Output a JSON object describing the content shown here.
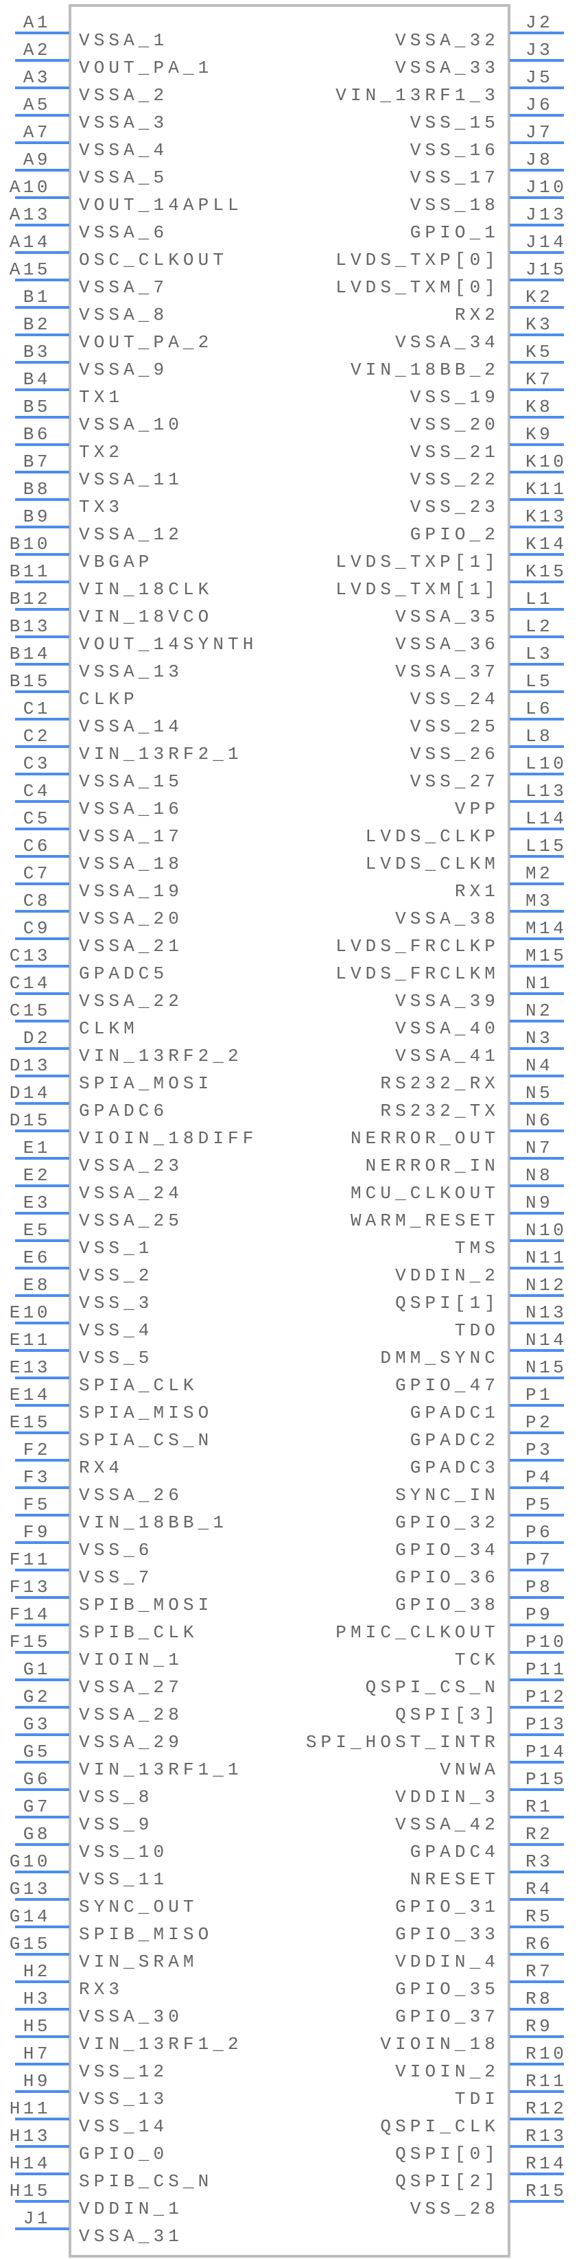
{
  "component": {
    "type": "schematic-symbol",
    "colors": {
      "body_outline": "#bdbdbd",
      "pin_line": "#4a8df0",
      "text": "#666666"
    },
    "left_pins": [
      {
        "pin": "A1",
        "name": "VSSA_1"
      },
      {
        "pin": "A2",
        "name": "VOUT_PA_1"
      },
      {
        "pin": "A3",
        "name": "VSSA_2"
      },
      {
        "pin": "A5",
        "name": "VSSA_3"
      },
      {
        "pin": "A7",
        "name": "VSSA_4"
      },
      {
        "pin": "A9",
        "name": "VSSA_5"
      },
      {
        "pin": "A10",
        "name": "VOUT_14APLL"
      },
      {
        "pin": "A13",
        "name": "VSSA_6"
      },
      {
        "pin": "A14",
        "name": "OSC_CLKOUT"
      },
      {
        "pin": "A15",
        "name": "VSSA_7"
      },
      {
        "pin": "B1",
        "name": "VSSA_8"
      },
      {
        "pin": "B2",
        "name": "VOUT_PA_2"
      },
      {
        "pin": "B3",
        "name": "VSSA_9"
      },
      {
        "pin": "B4",
        "name": "TX1"
      },
      {
        "pin": "B5",
        "name": "VSSA_10"
      },
      {
        "pin": "B6",
        "name": "TX2"
      },
      {
        "pin": "B7",
        "name": "VSSA_11"
      },
      {
        "pin": "B8",
        "name": "TX3"
      },
      {
        "pin": "B9",
        "name": "VSSA_12"
      },
      {
        "pin": "B10",
        "name": "VBGAP"
      },
      {
        "pin": "B11",
        "name": "VIN_18CLK"
      },
      {
        "pin": "B12",
        "name": "VIN_18VCO"
      },
      {
        "pin": "B13",
        "name": "VOUT_14SYNTH"
      },
      {
        "pin": "B14",
        "name": "VSSA_13"
      },
      {
        "pin": "B15",
        "name": "CLKP"
      },
      {
        "pin": "C1",
        "name": "VSSA_14"
      },
      {
        "pin": "C2",
        "name": "VIN_13RF2_1"
      },
      {
        "pin": "C3",
        "name": "VSSA_15"
      },
      {
        "pin": "C4",
        "name": "VSSA_16"
      },
      {
        "pin": "C5",
        "name": "VSSA_17"
      },
      {
        "pin": "C6",
        "name": "VSSA_18"
      },
      {
        "pin": "C7",
        "name": "VSSA_19"
      },
      {
        "pin": "C8",
        "name": "VSSA_20"
      },
      {
        "pin": "C9",
        "name": "VSSA_21"
      },
      {
        "pin": "C13",
        "name": "GPADC5"
      },
      {
        "pin": "C14",
        "name": "VSSA_22"
      },
      {
        "pin": "C15",
        "name": "CLKM"
      },
      {
        "pin": "D2",
        "name": "VIN_13RF2_2"
      },
      {
        "pin": "D13",
        "name": "SPIA_MOSI"
      },
      {
        "pin": "D14",
        "name": "GPADC6"
      },
      {
        "pin": "D15",
        "name": "VIOIN_18DIFF"
      },
      {
        "pin": "E1",
        "name": "VSSA_23"
      },
      {
        "pin": "E2",
        "name": "VSSA_24"
      },
      {
        "pin": "E3",
        "name": "VSSA_25"
      },
      {
        "pin": "E5",
        "name": "VSS_1"
      },
      {
        "pin": "E6",
        "name": "VSS_2"
      },
      {
        "pin": "E8",
        "name": "VSS_3"
      },
      {
        "pin": "E10",
        "name": "VSS_4"
      },
      {
        "pin": "E11",
        "name": "VSS_5"
      },
      {
        "pin": "E13",
        "name": "SPIA_CLK"
      },
      {
        "pin": "E14",
        "name": "SPIA_MISO"
      },
      {
        "pin": "E15",
        "name": "SPIA_CS_N"
      },
      {
        "pin": "F2",
        "name": "RX4"
      },
      {
        "pin": "F3",
        "name": "VSSA_26"
      },
      {
        "pin": "F5",
        "name": "VIN_18BB_1"
      },
      {
        "pin": "F9",
        "name": "VSS_6"
      },
      {
        "pin": "F11",
        "name": "VSS_7"
      },
      {
        "pin": "F13",
        "name": "SPIB_MOSI"
      },
      {
        "pin": "F14",
        "name": "SPIB_CLK"
      },
      {
        "pin": "F15",
        "name": "VIOIN_1"
      },
      {
        "pin": "G1",
        "name": "VSSA_27"
      },
      {
        "pin": "G2",
        "name": "VSSA_28"
      },
      {
        "pin": "G3",
        "name": "VSSA_29"
      },
      {
        "pin": "G5",
        "name": "VIN_13RF1_1"
      },
      {
        "pin": "G6",
        "name": "VSS_8"
      },
      {
        "pin": "G7",
        "name": "VSS_9"
      },
      {
        "pin": "G8",
        "name": "VSS_10"
      },
      {
        "pin": "G10",
        "name": "VSS_11"
      },
      {
        "pin": "G13",
        "name": "SYNC_OUT"
      },
      {
        "pin": "G14",
        "name": "SPIB_MISO"
      },
      {
        "pin": "G15",
        "name": "VIN_SRAM"
      },
      {
        "pin": "H2",
        "name": "RX3"
      },
      {
        "pin": "H3",
        "name": "VSSA_30"
      },
      {
        "pin": "H5",
        "name": "VIN_13RF1_2"
      },
      {
        "pin": "H7",
        "name": "VSS_12"
      },
      {
        "pin": "H9",
        "name": "VSS_13"
      },
      {
        "pin": "H11",
        "name": "VSS_14"
      },
      {
        "pin": "H13",
        "name": "GPIO_0"
      },
      {
        "pin": "H14",
        "name": "SPIB_CS_N"
      },
      {
        "pin": "H15",
        "name": "VDDIN_1"
      },
      {
        "pin": "J1",
        "name": "VSSA_31"
      }
    ],
    "right_pins": [
      {
        "pin": "J2",
        "name": "VSSA_32"
      },
      {
        "pin": "J3",
        "name": "VSSA_33"
      },
      {
        "pin": "J5",
        "name": "VIN_13RF1_3"
      },
      {
        "pin": "J6",
        "name": "VSS_15"
      },
      {
        "pin": "J7",
        "name": "VSS_16"
      },
      {
        "pin": "J8",
        "name": "VSS_17"
      },
      {
        "pin": "J10",
        "name": "VSS_18"
      },
      {
        "pin": "J13",
        "name": "GPIO_1"
      },
      {
        "pin": "J14",
        "name": "LVDS_TXP[0]"
      },
      {
        "pin": "J15",
        "name": "LVDS_TXM[0]"
      },
      {
        "pin": "K2",
        "name": "RX2"
      },
      {
        "pin": "K3",
        "name": "VSSA_34"
      },
      {
        "pin": "K5",
        "name": "VIN_18BB_2"
      },
      {
        "pin": "K7",
        "name": "VSS_19"
      },
      {
        "pin": "K8",
        "name": "VSS_20"
      },
      {
        "pin": "K9",
        "name": "VSS_21"
      },
      {
        "pin": "K10",
        "name": "VSS_22"
      },
      {
        "pin": "K11",
        "name": "VSS_23"
      },
      {
        "pin": "K13",
        "name": "GPIO_2"
      },
      {
        "pin": "K14",
        "name": "LVDS_TXP[1]"
      },
      {
        "pin": "K15",
        "name": "LVDS_TXM[1]"
      },
      {
        "pin": "L1",
        "name": "VSSA_35"
      },
      {
        "pin": "L2",
        "name": "VSSA_36"
      },
      {
        "pin": "L3",
        "name": "VSSA_37"
      },
      {
        "pin": "L5",
        "name": "VSS_24"
      },
      {
        "pin": "L6",
        "name": "VSS_25"
      },
      {
        "pin": "L8",
        "name": "VSS_26"
      },
      {
        "pin": "L10",
        "name": "VSS_27"
      },
      {
        "pin": "L13",
        "name": "VPP"
      },
      {
        "pin": "L14",
        "name": "LVDS_CLKP"
      },
      {
        "pin": "L15",
        "name": "LVDS_CLKM"
      },
      {
        "pin": "M2",
        "name": "RX1"
      },
      {
        "pin": "M3",
        "name": "VSSA_38"
      },
      {
        "pin": "M14",
        "name": "LVDS_FRCLKP"
      },
      {
        "pin": "M15",
        "name": "LVDS_FRCLKM"
      },
      {
        "pin": "N1",
        "name": "VSSA_39"
      },
      {
        "pin": "N2",
        "name": "VSSA_40"
      },
      {
        "pin": "N3",
        "name": "VSSA_41"
      },
      {
        "pin": "N4",
        "name": "RS232_RX"
      },
      {
        "pin": "N5",
        "name": "RS232_TX"
      },
      {
        "pin": "N6",
        "name": "NERROR_OUT"
      },
      {
        "pin": "N7",
        "name": "NERROR_IN"
      },
      {
        "pin": "N8",
        "name": "MCU_CLKOUT"
      },
      {
        "pin": "N9",
        "name": "WARM_RESET"
      },
      {
        "pin": "N10",
        "name": "TMS"
      },
      {
        "pin": "N11",
        "name": "VDDIN_2"
      },
      {
        "pin": "N12",
        "name": "QSPI[1]"
      },
      {
        "pin": "N13",
        "name": "TDO"
      },
      {
        "pin": "N14",
        "name": "DMM_SYNC"
      },
      {
        "pin": "N15",
        "name": "GPIO_47"
      },
      {
        "pin": "P1",
        "name": "GPADC1"
      },
      {
        "pin": "P2",
        "name": "GPADC2"
      },
      {
        "pin": "P3",
        "name": "GPADC3"
      },
      {
        "pin": "P4",
        "name": "SYNC_IN"
      },
      {
        "pin": "P5",
        "name": "GPIO_32"
      },
      {
        "pin": "P6",
        "name": "GPIO_34"
      },
      {
        "pin": "P7",
        "name": "GPIO_36"
      },
      {
        "pin": "P8",
        "name": "GPIO_38"
      },
      {
        "pin": "P9",
        "name": "PMIC_CLKOUT"
      },
      {
        "pin": "P10",
        "name": "TCK"
      },
      {
        "pin": "P11",
        "name": "QSPI_CS_N"
      },
      {
        "pin": "P12",
        "name": "QSPI[3]"
      },
      {
        "pin": "P13",
        "name": "SPI_HOST_INTR"
      },
      {
        "pin": "P14",
        "name": "VNWA"
      },
      {
        "pin": "P15",
        "name": "VDDIN_3"
      },
      {
        "pin": "R1",
        "name": "VSSA_42"
      },
      {
        "pin": "R2",
        "name": "GPADC4"
      },
      {
        "pin": "R3",
        "name": "NRESET"
      },
      {
        "pin": "R4",
        "name": "GPIO_31"
      },
      {
        "pin": "R5",
        "name": "GPIO_33"
      },
      {
        "pin": "R6",
        "name": "VDDIN_4"
      },
      {
        "pin": "R7",
        "name": "GPIO_35"
      },
      {
        "pin": "R8",
        "name": "GPIO_37"
      },
      {
        "pin": "R9",
        "name": "VIOIN_18"
      },
      {
        "pin": "R10",
        "name": "VIOIN_2"
      },
      {
        "pin": "R11",
        "name": "TDI"
      },
      {
        "pin": "R12",
        "name": "QSPI_CLK"
      },
      {
        "pin": "R13",
        "name": "QSPI[0]"
      },
      {
        "pin": "R14",
        "name": "QSPI[2]"
      },
      {
        "pin": "R15",
        "name": "VSS_28"
      }
    ]
  }
}
